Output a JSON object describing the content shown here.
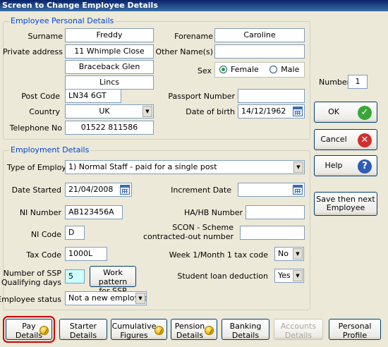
{
  "window": {
    "title": "Screen to Change Employee Details"
  },
  "personal": {
    "group_label": "Employee Personal Details",
    "surname_label": "Surname",
    "surname": "Freddy",
    "forename_label": "Forename",
    "forename": "Caroline",
    "address_label": "Private address",
    "address1": "11 Whimple Close",
    "address2": "Braceback Glen",
    "address3": "Lincs",
    "other_names_label": "Other Name(s)",
    "other_names": "",
    "sex_label": "Sex",
    "sex_female": "Female",
    "sex_male": "Male",
    "sex_selected": "Female",
    "postcode_label": "Post Code",
    "postcode": "LN34 6GT",
    "passport_label": "Passport Number",
    "passport": "",
    "country_label": "Country",
    "country": "UK",
    "dob_label": "Date of birth",
    "dob": "14/12/1962",
    "phone_label": "Telephone No",
    "phone": "01522 811586"
  },
  "number": {
    "label": "Number",
    "value": "1"
  },
  "side_buttons": {
    "ok": "OK",
    "cancel": "Cancel",
    "help": "Help",
    "save_next_line1": "Save then next",
    "save_next_line2": "Employee"
  },
  "colors": {
    "ok_icon": "#3aa63a",
    "cancel_icon": "#d12f2f",
    "help_icon": "#2f5bb7",
    "accent": "#0046d5",
    "selected_outline": "#d00000"
  },
  "employment": {
    "group_label": "Employment Details",
    "type_label": "Type of Employee",
    "type": "1)  Normal Staff - paid for a single post",
    "date_started_label": "Date Started",
    "date_started": "21/04/2008",
    "increment_label": "Increment Date",
    "increment": "",
    "ni_number_label": "NI Number",
    "ni_number": "AB123456A",
    "hahb_label": "HA/HB Number",
    "hahb": "",
    "ni_code_label": "NI Code",
    "ni_code": "D",
    "scon_label1": "SCON - Scheme",
    "scon_label2": "contracted-out number",
    "scon": "",
    "tax_code_label": "Tax Code",
    "tax_code": "1000L",
    "week1_label": "Week 1/Month 1 tax code",
    "week1": "No",
    "ssp_label1": "Number of SSP",
    "ssp_label2": "Qualifying days",
    "ssp_days": "5",
    "work_pattern_line1": "Work pattern",
    "work_pattern_line2": "for SSP",
    "student_loan_label": "Student loan deduction",
    "student_loan": "Yes",
    "status_label": "Employee status",
    "status": "Not a new employee"
  },
  "bottom_tabs": [
    {
      "line1": "Pay",
      "line2": "Details",
      "enabled": true,
      "selected": true,
      "icon": "coin-icon"
    },
    {
      "line1": "Starter",
      "line2": "Details",
      "enabled": true,
      "selected": false,
      "icon": ""
    },
    {
      "line1": "Cumulative",
      "line2": "Figures",
      "enabled": true,
      "selected": false,
      "icon": "coin-icon"
    },
    {
      "line1": "Pension",
      "line2": "Details",
      "enabled": true,
      "selected": false,
      "icon": "coin-icon"
    },
    {
      "line1": "Banking",
      "line2": "Details",
      "enabled": true,
      "selected": false,
      "icon": ""
    },
    {
      "line1": "Accounts",
      "line2": "Details",
      "enabled": false,
      "selected": false,
      "icon": ""
    },
    {
      "line1": "Personal",
      "line2": "Profile",
      "enabled": true,
      "selected": false,
      "icon": ""
    }
  ]
}
